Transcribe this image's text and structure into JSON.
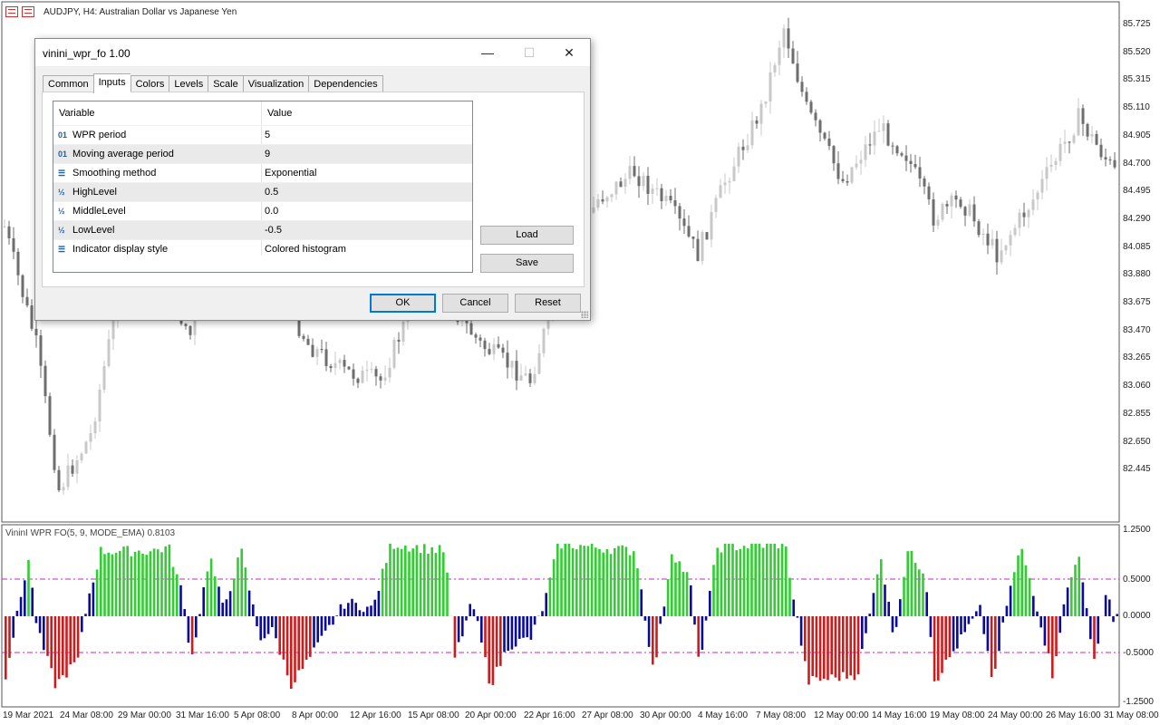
{
  "chart": {
    "title": "AUDJPY, H4:  Australian Dollar vs Japanese Yen",
    "price_labels": [
      "85.725",
      "85.520",
      "85.315",
      "85.110",
      "84.905",
      "84.700",
      "84.495",
      "84.290",
      "84.085",
      "83.880",
      "83.675",
      "83.470",
      "83.265",
      "83.060",
      "82.855",
      "82.650",
      "82.445"
    ],
    "time_labels": [
      "19 Mar 2021",
      "24 Mar 08:00",
      "29 Mar 00:00",
      "31 Mar 16:00",
      "5 Apr 08:00",
      "8 Apr 00:00",
      "12 Apr 16:00",
      "15 Apr 08:00",
      "20 Apr 00:00",
      "22 Apr 16:00",
      "27 Apr 08:00",
      "30 Apr 00:00",
      "4 May 16:00",
      "7 May 08:00",
      "12 May 00:00",
      "14 May 16:00",
      "19 May 08:00",
      "24 May 00:00",
      "26 May 16:00",
      "31 May 08:00"
    ],
    "indicator_title": "VininI WPR FO(5, 9, MODE_EMA) 0.8103",
    "indicator_scale": [
      "1.2500",
      "0.5000",
      "0.0000",
      "-0.5000",
      "-1.2500"
    ],
    "colors": {
      "up": "#32cd32",
      "down": "#ce1c1c",
      "neutral": "#0a0a9e",
      "level": "#cc22cc",
      "candle_bull": "#c8c8c8",
      "candle_bear": "#6e6e6e"
    }
  },
  "dialog": {
    "title": "vinini_wpr_fo 1.00",
    "minimize": "—",
    "maximize": "☐",
    "close": "✕",
    "tabs": [
      "Common",
      "Inputs",
      "Colors",
      "Levels",
      "Scale",
      "Visualization",
      "Dependencies"
    ],
    "active_tab": "Inputs",
    "grid_headers": {
      "variable": "Variable",
      "value": "Value"
    },
    "rows": [
      {
        "icon": "01",
        "icon_name": "integer-icon",
        "variable": "WPR period",
        "value": "5"
      },
      {
        "icon": "01",
        "icon_name": "integer-icon",
        "variable": "Moving average period",
        "value": "9"
      },
      {
        "icon": "☰",
        "icon_name": "enum-icon",
        "variable": "Smoothing method",
        "value": "Exponential"
      },
      {
        "icon": "½",
        "icon_name": "double-icon",
        "variable": "HighLevel",
        "value": "0.5"
      },
      {
        "icon": "½",
        "icon_name": "double-icon",
        "variable": "MiddleLevel",
        "value": "0.0"
      },
      {
        "icon": "½",
        "icon_name": "double-icon",
        "variable": "LowLevel",
        "value": "-0.5"
      },
      {
        "icon": "☰",
        "icon_name": "enum-icon",
        "variable": "Indicator display style",
        "value": "Colored histogram"
      }
    ],
    "load_label": "Load",
    "save_label": "Save",
    "ok_label": "OK",
    "cancel_label": "Cancel",
    "reset_label": "Reset"
  }
}
